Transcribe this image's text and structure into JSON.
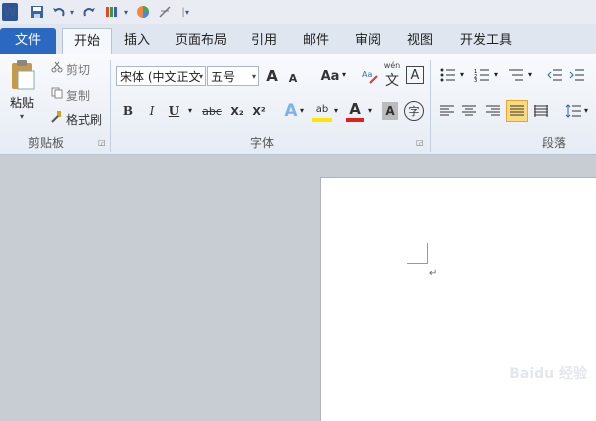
{
  "qat": {
    "undo_icon": "undo-icon",
    "redo_icon": "redo-icon"
  },
  "tabs": [
    {
      "label": "文件"
    },
    {
      "label": "开始"
    },
    {
      "label": "插入"
    },
    {
      "label": "页面布局"
    },
    {
      "label": "引用"
    },
    {
      "label": "邮件"
    },
    {
      "label": "审阅"
    },
    {
      "label": "视图"
    },
    {
      "label": "开发工具"
    }
  ],
  "clipboard": {
    "paste": "粘贴",
    "cut": "剪切",
    "copy": "复制",
    "format_painter": "格式刷",
    "group_label": "剪贴板"
  },
  "font": {
    "font_name": "宋体 (中文正文",
    "font_size": "五号",
    "grow": "A",
    "shrink": "A",
    "change_case": "Aa",
    "group_label": "字体",
    "bold": "B",
    "italic": "I",
    "underline": "U",
    "strike": "abc",
    "sub": "X₂",
    "sup": "X²",
    "text_effect": "A",
    "highlight": "ab",
    "font_color": "A",
    "char_shading": "A",
    "enclose": "字",
    "phonetic": "wén",
    "phonetic_char": "文",
    "border_char": "A"
  },
  "paragraph": {
    "group_label": "段落"
  },
  "watermark": "Baidu 经验"
}
